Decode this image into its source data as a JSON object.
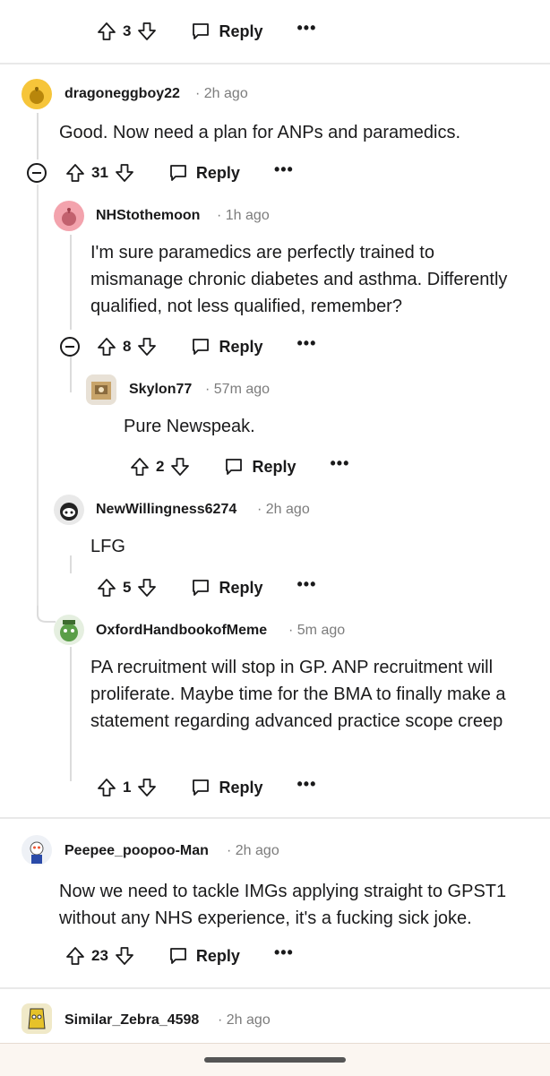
{
  "comments": [
    {
      "id": "top",
      "votes": "3",
      "reply_label": "Reply",
      "more": "•••"
    },
    {
      "id": "c1",
      "username": "dragoneggboy22",
      "time": "2h ago",
      "body": "Good. Now need a plan for ANPs and paramedics.",
      "votes": "31",
      "reply_label": "Reply",
      "more": "•••"
    },
    {
      "id": "c2",
      "username": "NHStothemoon",
      "time": "1h ago",
      "body": "I'm sure paramedics are perfectly trained to mismanage chronic diabetes and asthma. Differently qualified, not less qualified, remember?",
      "votes": "8",
      "reply_label": "Reply",
      "more": "•••"
    },
    {
      "id": "c3",
      "username": "Skylon77",
      "time": "57m ago",
      "body": "Pure Newspeak.",
      "votes": "2",
      "reply_label": "Reply",
      "more": "•••"
    },
    {
      "id": "c4",
      "username": "NewWillingness6274",
      "time": "2h ago",
      "body": "LFG",
      "votes": "5",
      "reply_label": "Reply",
      "more": "•••"
    },
    {
      "id": "c5",
      "username": "OxfordHandbookofMeme",
      "time": "5m ago",
      "body": "PA recruitment will stop in GP. ANP recruitment will proliferate. Maybe time for the BMA to finally make a statement regarding advanced practice scope creep",
      "votes": "1",
      "reply_label": "Reply",
      "more": "•••"
    },
    {
      "id": "c6",
      "username": "Peepee_poopoo-Man",
      "time": "2h ago",
      "body": "Now we need to tackle IMGs applying straight to GPST1 without any NHS experience, it's a fucking sick joke.",
      "votes": "23",
      "reply_label": "Reply",
      "more": "•••"
    },
    {
      "id": "c7",
      "username": "Similar_Zebra_4598",
      "time": "2h ago"
    }
  ],
  "icons": {
    "upvote": "arrow-up-outline-icon",
    "downvote": "arrow-down-outline-icon",
    "reply": "speech-bubble-icon",
    "more": "more-options-icon",
    "collapse": "collapse-thread-icon"
  },
  "colors": {
    "text": "#1a1a1b",
    "meta": "#7c7c7c",
    "thread_line": "#dcdcdc",
    "bottom_bar": "#fbf6f1"
  }
}
